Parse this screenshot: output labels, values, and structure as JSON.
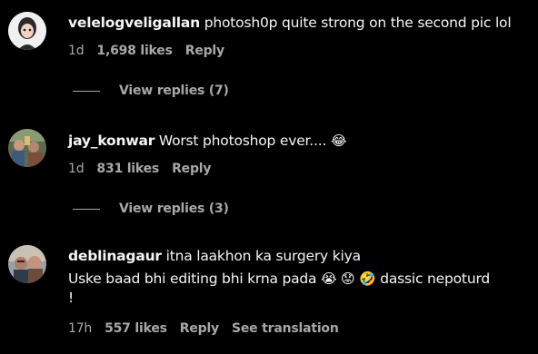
{
  "comments": [
    {
      "username": "velelogveligallan",
      "text": " photosh0p quite strong on the second pic lol",
      "time": "1d",
      "likes": "1,698 likes",
      "reply_label": "Reply",
      "view_replies": "View replies (7)",
      "avatar_colors": [
        "#e9e9e9",
        "#2b2b2b"
      ]
    },
    {
      "username": "jay_konwar",
      "text": " Worst photoshop ever....",
      "emoji": "😂",
      "time": "1d",
      "likes": "831 likes",
      "reply_label": "Reply",
      "view_replies": "View replies (3)",
      "avatar_colors": [
        "#6b7f5a",
        "#c7b0a0"
      ]
    },
    {
      "username": "deblinagaur",
      "text": " itna laakhon ka surgery kiya",
      "line2": "Uske baad bhi editing bhi krna pada ",
      "emojis": "😭 😟  🤣",
      "line2_end": " dassic nepoturd",
      "line3": "!",
      "time": "17h",
      "likes": "557 likes",
      "reply_label": "Reply",
      "see_translation": "See translation",
      "avatar_colors": [
        "#a39a8c",
        "#3c3c3c"
      ]
    }
  ]
}
